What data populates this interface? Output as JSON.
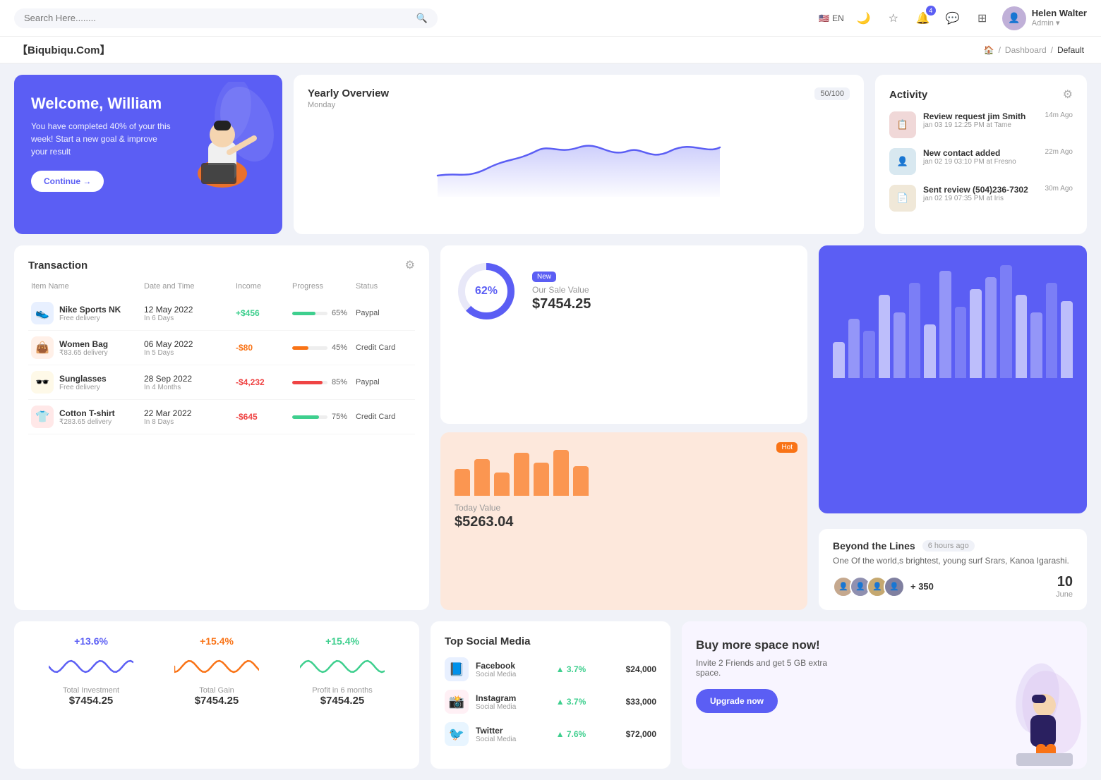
{
  "topnav": {
    "search_placeholder": "Search Here........",
    "lang": "EN",
    "user": {
      "name": "Helen Walter",
      "role": "Admin"
    },
    "bell_badge": "4"
  },
  "breadcrumb": {
    "brand": "【Biqubiqu.Com】",
    "items": [
      "Dashboard",
      "Default"
    ]
  },
  "welcome": {
    "title": "Welcome, William",
    "subtitle": "You have completed 40% of your this week! Start a new goal & improve your result",
    "button": "Continue →"
  },
  "yearly_overview": {
    "title": "Yearly Overview",
    "subtitle": "Monday",
    "badge": "50/100"
  },
  "activity": {
    "title": "Activity",
    "items": [
      {
        "name": "Review request jim Smith",
        "detail": "jan 03 19 12:25 PM at Tame",
        "time": "14m Ago"
      },
      {
        "name": "New contact added",
        "detail": "jan 02 19 03:10 PM at Fresno",
        "time": "22m Ago"
      },
      {
        "name": "Sent review (504)236-7302",
        "detail": "jan 02 19 07:35 PM at Iris",
        "time": "30m Ago"
      }
    ]
  },
  "transaction": {
    "title": "Transaction",
    "columns": [
      "Item Name",
      "Date and Time",
      "Income",
      "Progress",
      "Status"
    ],
    "rows": [
      {
        "name": "Nike Sports NK",
        "sub": "Free delivery",
        "icon": "👟",
        "icon_bg": "#e8f0ff",
        "date": "12 May 2022",
        "days": "In 6 Days",
        "income": "+$456",
        "income_class": "positive",
        "progress": 65,
        "progress_color": "#3ecf8e",
        "status": "Paypal"
      },
      {
        "name": "Women Bag",
        "sub": "₹83.65 delivery",
        "icon": "👜",
        "icon_bg": "#fff0e8",
        "date": "06 May 2022",
        "days": "In 5 Days",
        "income": "-$80",
        "income_class": "negative-orange",
        "progress": 45,
        "progress_color": "#f97316",
        "status": "Credit Card"
      },
      {
        "name": "Sunglasses",
        "sub": "Free delivery",
        "icon": "🕶️",
        "icon_bg": "#fef9e8",
        "date": "28 Sep 2022",
        "days": "In 4 Months",
        "income": "-$4,232",
        "income_class": "negative-red",
        "progress": 85,
        "progress_color": "#ef4444",
        "status": "Paypal"
      },
      {
        "name": "Cotton T-shirt",
        "sub": "₹283.65 delivery",
        "icon": "👕",
        "icon_bg": "#ffe8e8",
        "date": "22 Mar 2022",
        "days": "In 8 Days",
        "income": "-$645",
        "income_class": "negative-red",
        "progress": 75,
        "progress_color": "#3ecf8e",
        "status": "Credit Card"
      }
    ]
  },
  "sale_value": {
    "badge": "New",
    "percent": "62%",
    "label": "Our Sale Value",
    "value": "$7454.25"
  },
  "today_value": {
    "badge": "Hot",
    "label": "Today Value",
    "value": "$5263.04",
    "bars": [
      40,
      55,
      35,
      65,
      50,
      70,
      45
    ]
  },
  "bar_chart": {
    "bars": [
      30,
      50,
      40,
      70,
      55,
      80,
      45,
      90,
      60,
      75,
      85,
      95,
      70,
      55,
      80,
      65
    ]
  },
  "beyond": {
    "title": "Beyond the Lines",
    "time": "6 hours ago",
    "desc": "One Of the world,s brightest, young surf Srars, Kanoa Igarashi.",
    "plus_count": "+ 350",
    "date_num": "10",
    "date_month": "June"
  },
  "stats": [
    {
      "pct": "+13.6%",
      "color": "#5b5ef4",
      "name": "Total Investment",
      "value": "$7454.25"
    },
    {
      "pct": "+15.4%",
      "color": "#f97316",
      "name": "Total Gain",
      "value": "$7454.25"
    },
    {
      "pct": "+15.4%",
      "color": "#3ecf8e",
      "name": "Profit in 6 months",
      "value": "$7454.25"
    }
  ],
  "social": {
    "title": "Top Social Media",
    "items": [
      {
        "name": "Facebook",
        "sub": "Social Media",
        "icon": "📘",
        "icon_bg": "#e8f0ff",
        "pct": "3.7%",
        "value": "$24,000"
      },
      {
        "name": "Instagram",
        "sub": "Social Media",
        "icon": "📸",
        "icon_bg": "#fff0f5",
        "pct": "3.7%",
        "value": "$33,000"
      },
      {
        "name": "Twitter",
        "sub": "Social Media",
        "icon": "🐦",
        "icon_bg": "#e8f5ff",
        "pct": "7.6%",
        "value": "$72,000"
      }
    ]
  },
  "upgrade": {
    "title": "Buy more space now!",
    "desc": "Invite 2 Friends and get 5 GB extra space.",
    "button": "Upgrade now"
  }
}
